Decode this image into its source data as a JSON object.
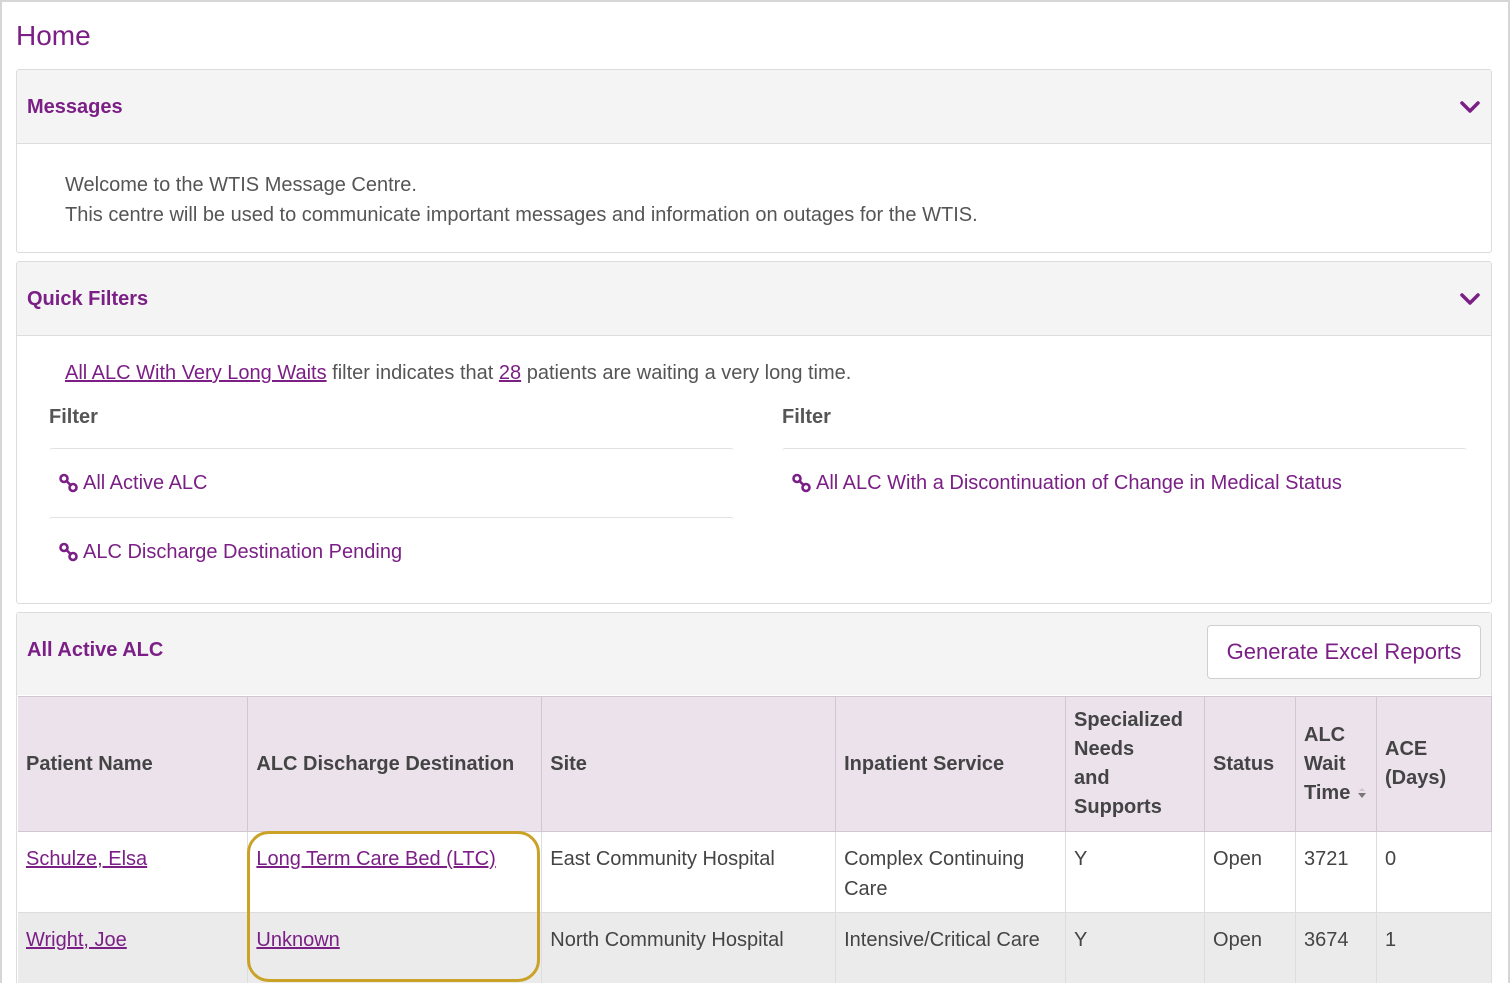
{
  "page": {
    "title": "Home"
  },
  "messages": {
    "title": "Messages",
    "lines": [
      "Welcome to the WTIS Message Centre.",
      "This centre will be used to communicate important messages and information on outages for the WTIS."
    ]
  },
  "quick_filters": {
    "title": "Quick Filters",
    "notice": {
      "link_text": "All ALC With Very Long Waits",
      "middle_text": "filter indicates that",
      "count": "28",
      "end_text": "patients are waiting a very long time."
    },
    "columns": [
      {
        "heading": "Filter",
        "items": [
          "All Active ALC",
          "ALC Discharge Destination Pending"
        ]
      },
      {
        "heading": "Filter",
        "items": [
          "All ALC With a Discontinuation of Change in Medical Status"
        ]
      }
    ]
  },
  "alc_panel": {
    "title": "All Active ALC",
    "generate_button": "Generate Excel Reports",
    "headers": {
      "patient_name": "Patient Name",
      "destination": "ALC Discharge Destination",
      "site": "Site",
      "inpatient_service": "Inpatient Service",
      "specialized_1": "Specialized",
      "specialized_2": "Needs",
      "specialized_3": "and",
      "specialized_4": "Supports",
      "status": "Status",
      "alc_wait_1": "ALC",
      "alc_wait_2": "Wait",
      "alc_wait_3": "Time",
      "ace_1": "ACE",
      "ace_2": "(Days)"
    },
    "rows": [
      {
        "patient": "Schulze, Elsa",
        "destination": "Long Term Care Bed (LTC)",
        "site": "East Community Hospital",
        "service_1": "Complex Continuing",
        "service_2": "Care",
        "specialized": "Y",
        "status": "Open",
        "alc_wait": "3721",
        "ace": "0"
      },
      {
        "patient": "Wright, Joe",
        "destination": "Unknown",
        "site": "North Community Hospital",
        "service_1": "Intensive/Critical Care",
        "service_2": "",
        "specialized": "Y",
        "status": "Open",
        "alc_wait": "3674",
        "ace": "1"
      }
    ]
  },
  "colors": {
    "accent": "#7b1f86",
    "header_bg": "#ebe2ec",
    "highlight": "#c9a227"
  }
}
